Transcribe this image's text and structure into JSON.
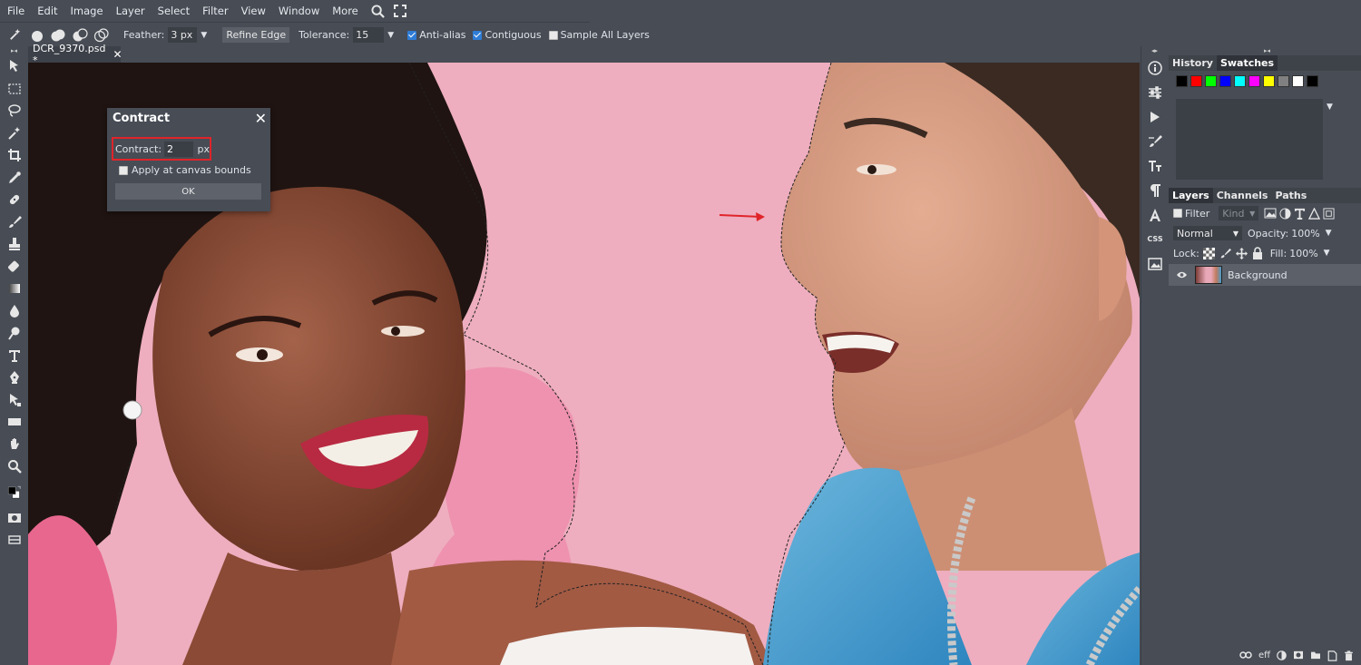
{
  "menubar": {
    "items": [
      "File",
      "Edit",
      "Image",
      "Layer",
      "Select",
      "Filter",
      "View",
      "Window",
      "More"
    ]
  },
  "options": {
    "feather_label": "Feather:",
    "feather_value": "3 px",
    "refine_edge": "Refine Edge",
    "tolerance_label": "Tolerance:",
    "tolerance_value": "15",
    "anti_alias": "Anti-alias",
    "contiguous": "Contiguous",
    "sample_all_layers": "Sample All Layers"
  },
  "tab": {
    "name": "DCR_9370.psd *",
    "close": "✕"
  },
  "dialog": {
    "title": "Contract",
    "close": "✕",
    "contract_label": "Contract:",
    "contract_value": "2",
    "contract_unit": "px",
    "apply_bounds": "Apply at canvas bounds",
    "ok": "OK"
  },
  "midstrip": {
    "css_label": "CSS"
  },
  "panels": {
    "top_tabs": [
      "History",
      "Swatches"
    ],
    "swatch_colors": [
      "#000000",
      "#ff0000",
      "#00ff00",
      "#0000ff",
      "#00ffff",
      "#ff00ff",
      "#ffff00",
      "#808080",
      "#ffffff",
      "#000000"
    ],
    "layer_tabs": [
      "Layers",
      "Channels",
      "Paths"
    ],
    "filter_label": "Filter",
    "kind_label": "Kind",
    "blend_mode": "Normal",
    "opacity_label": "Opacity:",
    "opacity_value": "100%",
    "lock_label": "Lock:",
    "fill_label": "Fill:",
    "fill_value": "100%",
    "layer_name": "Background",
    "bottom_eff": "eff"
  },
  "colors": {
    "accent": "#2e7cd6",
    "highlight_box": "#e0242a",
    "panel_bg": "#474c55",
    "canvas_bg": "#eeaebf"
  }
}
